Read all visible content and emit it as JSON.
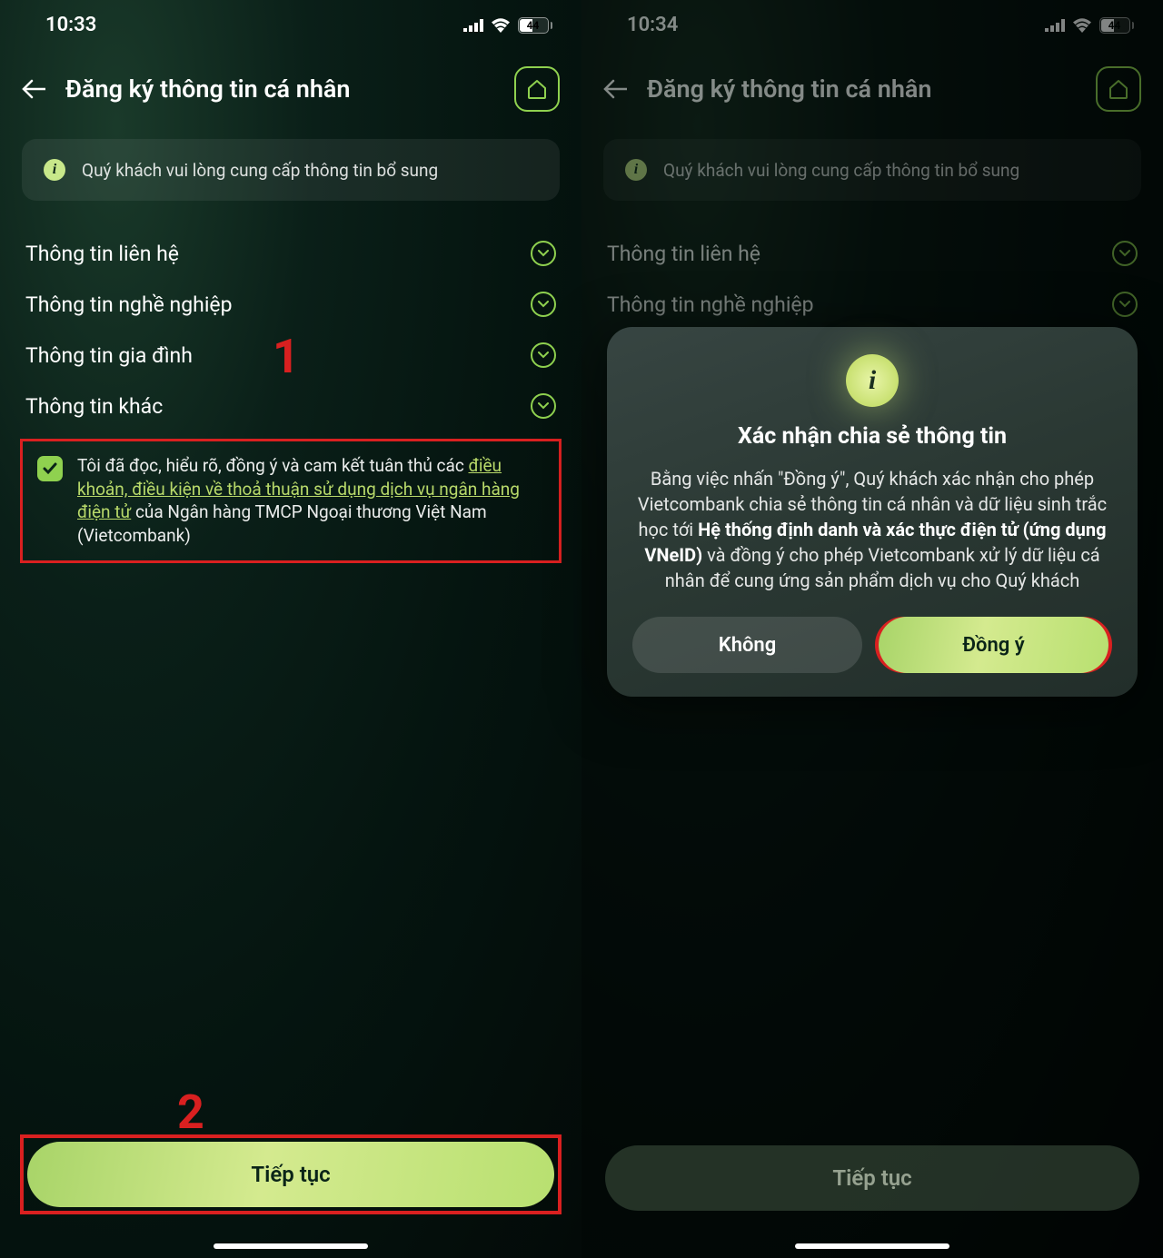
{
  "left": {
    "status": {
      "time": "10:33",
      "battery": "44"
    },
    "title": "Đăng ký thông tin cá nhân",
    "banner": "Quý khách vui lòng cung cấp thông tin bổ sung",
    "sections": [
      "Thông tin liên hệ",
      "Thông tin nghề nghiệp",
      "Thông tin gia đình",
      "Thông tin khác"
    ],
    "consent_pre": "Tôi đã đọc, hiểu rõ, đồng ý và cam kết tuân thủ các ",
    "consent_link": "điều khoản, điều kiện về thoả thuận sử dụng dịch vụ ngân hàng điện tử",
    "consent_post": " của Ngân hàng TMCP Ngoại thương Việt Nam (Vietcombank)",
    "cta": "Tiếp tục",
    "annotation1": "1",
    "annotation2": "2"
  },
  "right": {
    "status": {
      "time": "10:34",
      "battery": "44"
    },
    "title": "Đăng ký thông tin cá nhân",
    "banner": "Quý khách vui lòng cung cấp thông tin bổ sung",
    "sections": [
      "Thông tin liên hệ",
      "Thông tin nghề nghiệp"
    ],
    "modal": {
      "title": "Xác nhận chia sẻ thông tin",
      "body_1": "Bằng việc nhấn \"Đồng ý\", Quý khách xác nhận cho phép Vietcombank chia sẻ thông tin cá nhân và dữ liệu sinh trắc học tới ",
      "body_bold": "Hệ thống định danh và xác thực điện tử (ứng dụng VNeID)",
      "body_2": " và đồng ý cho phép Vietcombank xử lý dữ liệu cá nhân để cung ứng sản phẩm dịch vụ cho Quý khách",
      "no": "Không",
      "yes": "Đồng ý"
    },
    "cta": "Tiếp tục"
  }
}
